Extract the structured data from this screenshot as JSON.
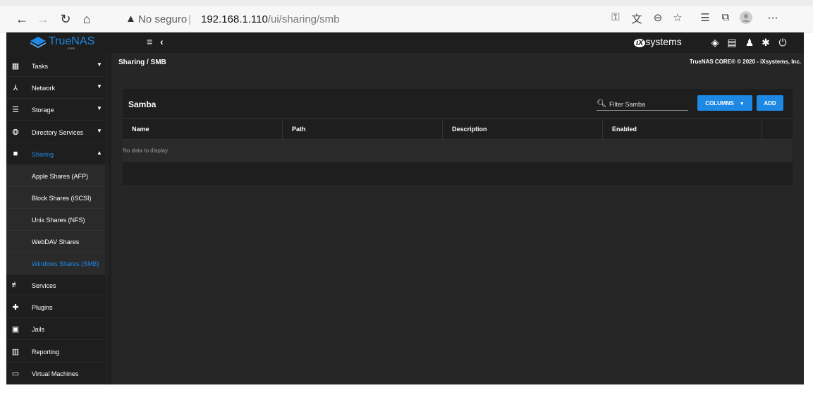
{
  "browser": {
    "security_label": "No seguro",
    "url_host": "192.168.1.110",
    "url_path": "/ui/sharing/smb",
    "icons": [
      "back-icon",
      "forward-icon",
      "refresh-icon",
      "home-icon",
      "warning-icon",
      "key-icon",
      "translate-icon",
      "zoom-icon",
      "favorite-icon",
      "favorites-bar-icon",
      "collections-icon",
      "profile-icon",
      "more-icon"
    ]
  },
  "topbar": {
    "logo_text": "TrueNAS",
    "logo_sub": "CORE",
    "vendor_text": "systems",
    "vendor_mark": "iX"
  },
  "sidebar": {
    "items": [
      {
        "label": "Tasks",
        "icon": "calendar-icon",
        "expandable": true
      },
      {
        "label": "Network",
        "icon": "network-icon",
        "expandable": true
      },
      {
        "label": "Storage",
        "icon": "storage-icon",
        "expandable": true
      },
      {
        "label": "Directory Services",
        "icon": "directory-icon",
        "expandable": true
      },
      {
        "label": "Sharing",
        "icon": "folder-shared-icon",
        "expandable": true,
        "expanded": true
      },
      {
        "label": "Services",
        "icon": "tune-icon",
        "expandable": false
      },
      {
        "label": "Plugins",
        "icon": "extension-icon",
        "expandable": false
      },
      {
        "label": "Jails",
        "icon": "jail-icon",
        "expandable": false
      },
      {
        "label": "Reporting",
        "icon": "chart-icon",
        "expandable": false
      },
      {
        "label": "Virtual Machines",
        "icon": "monitor-icon",
        "expandable": false
      }
    ],
    "sharing_children": [
      {
        "label": "Apple Shares (AFP)"
      },
      {
        "label": "Block Shares (iSCSI)"
      },
      {
        "label": "Unix Shares (NFS)"
      },
      {
        "label": "WebDAV Shares"
      },
      {
        "label": "Windows Shares (SMB)"
      }
    ]
  },
  "main": {
    "breadcrumb": "Sharing / SMB",
    "copyright": "TrueNAS CORE® © 2020 - iXsystems, Inc.",
    "card_title": "Samba",
    "filter_placeholder": "Filter Samba",
    "columns_label": "COLUMNS",
    "add_label": "ADD",
    "columns": [
      "Name",
      "Path",
      "Description",
      "Enabled"
    ],
    "empty_text": "No data to display"
  },
  "colors": {
    "accent": "#1e88e5",
    "background": "#262626",
    "panel": "#1e1e1e"
  }
}
